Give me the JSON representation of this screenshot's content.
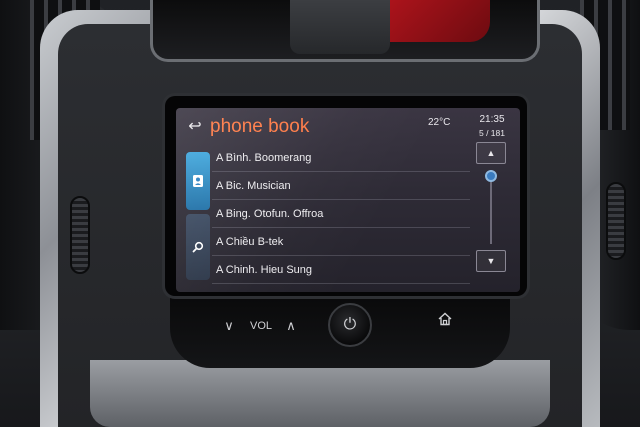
{
  "screen": {
    "title": "phone book",
    "back_icon": "back-arrow-icon",
    "temperature": "22°C",
    "time": "21:35",
    "page_count": "5 / 181"
  },
  "side_tabs": [
    {
      "icon": "contacts-icon",
      "active": true
    },
    {
      "icon": "search-icon",
      "active": false
    }
  ],
  "contacts": [
    "A Bình. Boomerang",
    "A Bic. Musician",
    "A Bing. Otofun. Offroa",
    "A Chiều B-tek",
    "A Chinh. Hieu Sung"
  ],
  "scroll": {
    "up_icon": "triangle-up-icon",
    "down_icon": "triangle-down-icon",
    "position": 0
  },
  "hardware": {
    "vol_label": "VOL",
    "vol_down_icon": "chevron-down-icon",
    "vol_up_icon": "chevron-up-icon",
    "power_icon": "power-icon",
    "home_icon": "home-icon"
  },
  "colors": {
    "title": "#ff7a45",
    "active_tab": "#3fa6dc"
  }
}
